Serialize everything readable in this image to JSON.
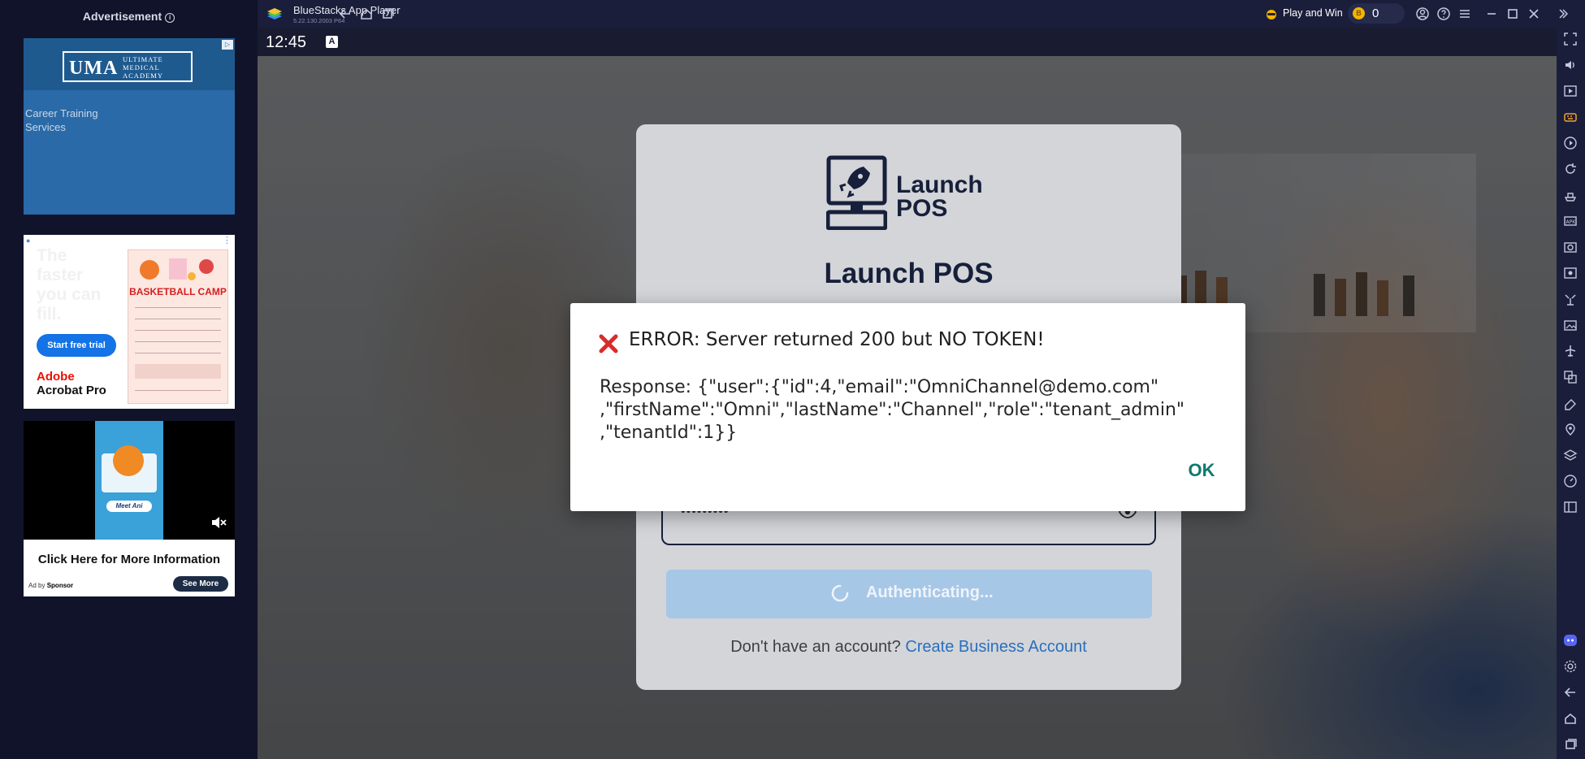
{
  "ad_panel": {
    "title": "Advertisement",
    "ad1": {
      "abbr": "UMA",
      "name": "ULTIMATE MEDICAL ACADEMY",
      "text": "Career Training Services"
    },
    "ad2": {
      "tagline": "The faster you can fill.",
      "button": "Start free trial",
      "brand_line1": "Adobe",
      "brand_line2": "Acrobat Pro",
      "poster_title": "BASKETBALL CAMP"
    },
    "ad3": {
      "tag": "Meet Ani",
      "cta": "Click Here for More Information",
      "ad_by": "Ad by",
      "sponsor": "Sponsor",
      "more_button": "See More"
    }
  },
  "titlebar": {
    "app_name": "BlueStacks App Player",
    "version": "5.22.130.2003 P64",
    "play_and_win": "Play and Win",
    "coins": "0"
  },
  "statusbar": {
    "time": "12:45"
  },
  "login": {
    "logo_line1": "Launch",
    "logo_line2": "POS",
    "title": "Launch POS",
    "password_mask": "•••••••••",
    "auth_button": "Authenticating...",
    "signup_prompt": "Don't have an account?",
    "signup_link": "Create Business Account"
  },
  "dialog": {
    "title": "ERROR: Server returned 200 but NO TOKEN!",
    "body_line1": "Response: {\"user\":{\"id\":4,\"email\":\"OmniChannel@demo.com\"",
    "body_line2": ",\"firstName\":\"Omni\",\"lastName\":\"Channel\",\"role\":\"tenant_admin\"",
    "body_line3": ",\"tenantId\":1}}",
    "ok_button": "OK"
  },
  "colors": {
    "bluestacks_chrome": "#1b1e3a",
    "dialog_ok": "#0e7a6e",
    "link": "#2a6fbd",
    "auth_button": "#a7c7e7"
  }
}
